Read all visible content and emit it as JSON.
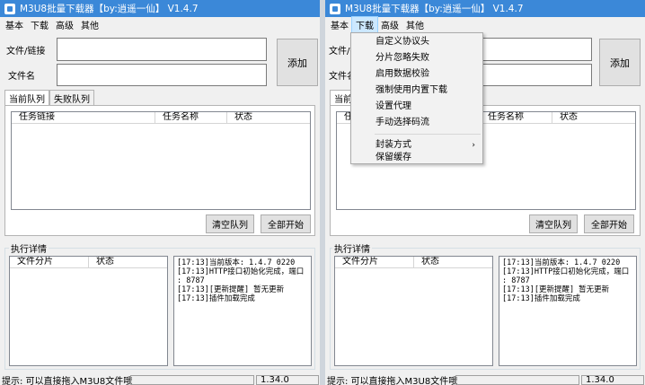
{
  "title": "M3U8批量下载器【by:逍遥一仙】 V1.4.7",
  "menu": [
    "基本",
    "下载",
    "高级",
    "其他"
  ],
  "form": {
    "url_label": "文件/链接",
    "filename_label": "文件名",
    "add_button": "添加",
    "url_value": "",
    "filename_value": ""
  },
  "tabs": [
    "当前队列",
    "失败队列"
  ],
  "queue_columns": [
    "任务链接",
    "任务名称",
    "状态"
  ],
  "buttons": {
    "clear_queue": "清空队列",
    "start_all": "全部开始"
  },
  "details": {
    "group_title": "执行详情",
    "columns": [
      "文件分片",
      "状态"
    ],
    "log": "[17:13]当前版本: 1.4.7 0220\n[17:13]HTTP接口初始化完成，端口\n: 8787\n[17:13][更新提醒] 暂无更新\n[17:13]插件加载完成"
  },
  "status": {
    "hint": "提示: 可以直接拖入M3U8文件哦",
    "version": "1.34.0"
  },
  "download_menu": {
    "items": [
      "自定义协议头",
      "分片忽略失败",
      "启用数据校验",
      "强制使用内置下载",
      "设置代理",
      "手动选择码流"
    ],
    "items2": [
      "封装方式",
      "保留缓存"
    ],
    "submenu_arrow": "›"
  },
  "colors": {
    "titlebar": "#3b88d8",
    "menu_highlight": "#cce8ff"
  }
}
